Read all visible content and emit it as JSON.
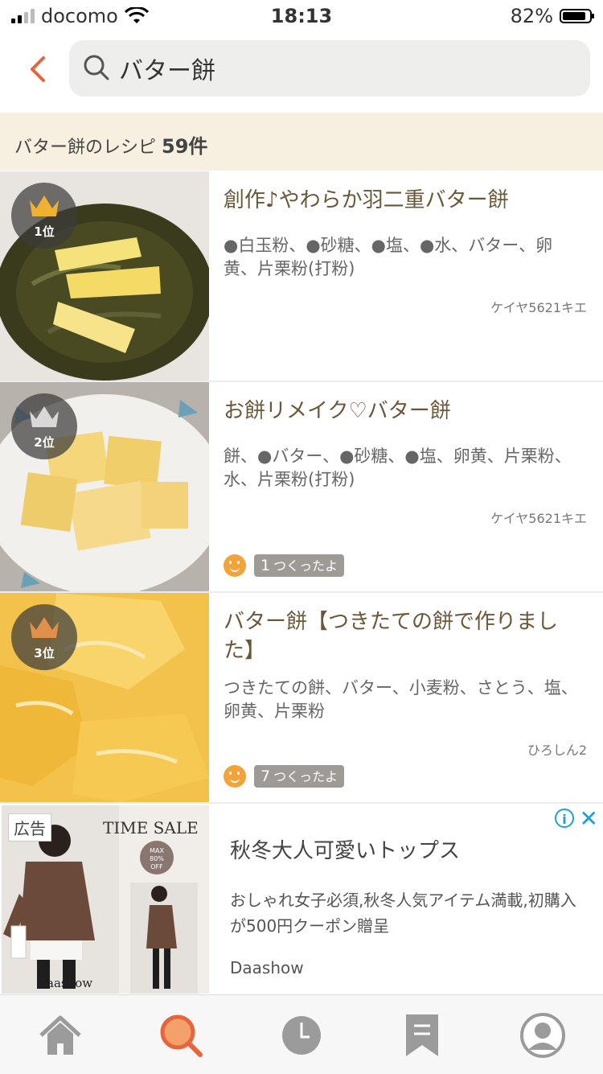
{
  "status": {
    "carrier": "docomo",
    "time": "18:13",
    "battery": "82%"
  },
  "search": {
    "query": "バター餅"
  },
  "results": {
    "label": "バター餅のレシピ",
    "count": "59件"
  },
  "recipes": [
    {
      "rank": "1位",
      "rank_color": "#f0b030",
      "title": "創作♪やわらか羽二重バター餅",
      "ingredients": "●白玉粉、●砂糖、●塩、●水、バター、卵黄、片栗粉(打粉)",
      "author": "ケイヤ5621キエ"
    },
    {
      "rank": "2位",
      "rank_color": "#d8d8d8",
      "title": "お餅リメイク♡バター餅",
      "ingredients": "餅、●バター、●砂糖、●塩、卵黄、片栗粉、水、片栗粉(打粉)",
      "author": "ケイヤ5621キエ",
      "tsukurepo_count": "1",
      "tsukurepo_label": "つくったよ"
    },
    {
      "rank": "3位",
      "rank_color": "#e0904a",
      "title": "バター餅【つきたての餅で作りました】",
      "ingredients": "つきたての餅、バター、小麦粉、さとう、塩、卵黄、片栗粉",
      "author": "ひろしん2",
      "tsukurepo_count": "7",
      "tsukurepo_label": "つくったよ"
    }
  ],
  "ad": {
    "label": "広告",
    "image_text": "TIME SALE",
    "badge_line1": "MAX",
    "badge_line2": "80%",
    "badge_line3": "OFF",
    "brand_logo": "Daashow",
    "headline": "秋冬大人可愛いトップス",
    "description": "おしゃれ女子必須,秋冬人気アイテム満載,初購入が500円クーポン贈呈",
    "advertiser": "Daashow"
  },
  "tabbar": {
    "active_color": "#e8643c",
    "inactive_color": "#9b9b9b"
  }
}
